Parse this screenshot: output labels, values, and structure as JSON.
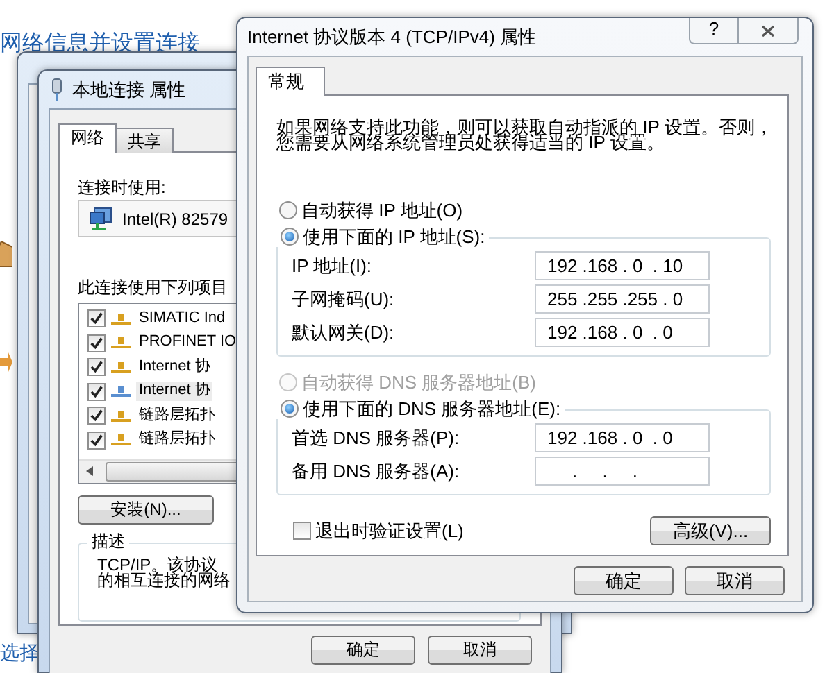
{
  "background_window": {
    "title": "网络信息并设置连接",
    "bottom_link": "选择"
  },
  "properties_window": {
    "title": "本地连接 属性",
    "tabs": [
      {
        "label": "网络",
        "selected": true
      },
      {
        "label": "共享",
        "selected": false
      }
    ],
    "connect_using_label": "连接时使用:",
    "adapter": "Intel(R) 82579",
    "items_label": "此连接使用下列项目",
    "items": [
      {
        "label": "SIMATIC Ind",
        "checked": true,
        "selected": false
      },
      {
        "label": "PROFINET IO",
        "checked": true,
        "selected": false
      },
      {
        "label": "Internet 协",
        "checked": true,
        "selected": false
      },
      {
        "label": "Internet 协",
        "checked": true,
        "selected": true
      },
      {
        "label": "链路层拓扑",
        "checked": true,
        "selected": false
      },
      {
        "label": "链路层拓扑",
        "checked": true,
        "selected": false
      }
    ],
    "install_button": "安装(N)...",
    "description": {
      "title": "描述",
      "lines": [
        "TCP/IP。该协议",
        "的相互连接的网络"
      ]
    },
    "footer_buttons": [
      "确定",
      "取消"
    ]
  },
  "ipv4_window": {
    "title": "Internet 协议版本 4 (TCP/IPv4) 属性",
    "help": "?",
    "tabs": [
      {
        "label": "常规",
        "selected": true
      }
    ],
    "intro_lines": [
      "如果网络支持此功能，则可以获取自动指派的 IP 设置。否则，",
      "您需要从网络系统管理员处获得适当的 IP 设置。"
    ],
    "ip_options": [
      {
        "label": "自动获得 IP 地址(O)",
        "selected": false,
        "disabled": false
      },
      {
        "label": "使用下面的 IP 地址(S):",
        "selected": true,
        "disabled": false
      }
    ],
    "ip_fields": [
      {
        "label": "IP 地址(I):",
        "value": "192 .168 . 0  . 10"
      },
      {
        "label": "子网掩码(U):",
        "value": "255 .255 .255 . 0"
      },
      {
        "label": "默认网关(D):",
        "value": "192 .168 . 0  . 0"
      }
    ],
    "dns_options": [
      {
        "label": "自动获得 DNS 服务器地址(B)",
        "selected": false,
        "disabled": true
      },
      {
        "label": "使用下面的 DNS 服务器地址(E):",
        "selected": true,
        "disabled": false
      }
    ],
    "dns_fields": [
      {
        "label": "首选 DNS 服务器(P):",
        "value": "192 .168 . 0  . 0"
      },
      {
        "label": "备用 DNS 服务器(A):",
        "value": "     .     .     ."
      }
    ],
    "validate": {
      "label": "退出时验证设置(L)",
      "checked": false
    },
    "advanced_button": "高级(V)...",
    "footer_buttons": [
      "确定",
      "取消"
    ]
  }
}
